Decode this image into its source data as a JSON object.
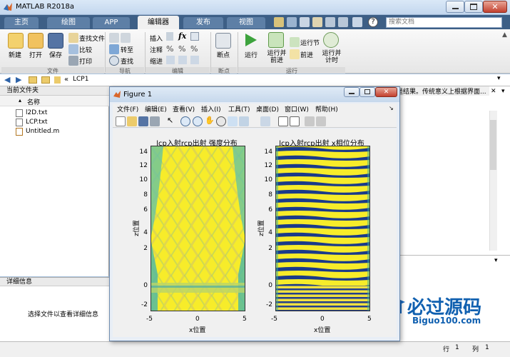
{
  "window": {
    "title": "MATLAB R2018a"
  },
  "tabs": [
    {
      "label": "主页"
    },
    {
      "label": "绘图"
    },
    {
      "label": "APP"
    },
    {
      "label": "编辑器"
    },
    {
      "label": "发布"
    },
    {
      "label": "视图"
    }
  ],
  "search": {
    "placeholder": "搜索文档"
  },
  "ribbon": {
    "file": {
      "new": "新建",
      "open": "打开",
      "save": "保存",
      "find_files": "查找文件",
      "compare": "比较",
      "print": "打印",
      "group": "文件"
    },
    "navigate": {
      "goto": "转至",
      "find": "查找",
      "group": "导航"
    },
    "edit": {
      "insert": "插入",
      "comment": "注释",
      "indent": "缩进",
      "fx": "fx",
      "group": "编辑"
    },
    "breakpoints": {
      "label": "断点",
      "group": "断点"
    },
    "run": {
      "run": "运行",
      "run_advance": "运行并前进",
      "run_section": "运行节",
      "advance": "前进",
      "run_time": "运行并计时",
      "group": "运行"
    }
  },
  "address": {
    "path": "LCP1",
    "prefix": "«"
  },
  "file_panel": {
    "title": "当前文件夹",
    "col_name": "名称",
    "files": [
      {
        "name": "l2D.txt"
      },
      {
        "name": "LCP.txt"
      },
      {
        "name": "Untitled.m"
      }
    ]
  },
  "details": {
    "title": "详细信息",
    "message": "选择文件以查看详细信息"
  },
  "editor_hint": "是结果。传统意义上根据界面...",
  "status": {
    "row_label": "行",
    "row": "1",
    "col_label": "列",
    "col": "1"
  },
  "figure": {
    "title": "Figure 1",
    "menus": [
      "文件(F)",
      "编辑(E)",
      "查看(V)",
      "插入(I)",
      "工具(T)",
      "桌面(D)",
      "窗口(W)",
      "帮助(H)"
    ],
    "plots": [
      {
        "title": "lcp入射rcp出射 强度分布",
        "xlabel": "x位置",
        "ylabel": "z位置",
        "xticks": [
          "-5",
          "0",
          "5"
        ],
        "yticks": [
          "14",
          "12",
          "10",
          "8",
          "6",
          "4",
          "2",
          "0",
          "-2"
        ]
      },
      {
        "title": "lcp入射rcp出射 x相位分布",
        "xlabel": "x位置",
        "ylabel": "z位置",
        "xticks": [
          "-5",
          "0",
          "5"
        ],
        "yticks": [
          "14",
          "12",
          "10",
          "8",
          "6",
          "4",
          "2",
          "0",
          "-2"
        ]
      }
    ]
  },
  "watermark": {
    "brand": "必过源码",
    "site": "Biguo100.com"
  },
  "colors": {
    "titlebar": "#c3d7ee",
    "tabrow": "#3d5f86",
    "plot_yellow": "#f7ec2a",
    "plot_blue": "#1a3a8a",
    "plot_teal": "#49b8a8"
  }
}
